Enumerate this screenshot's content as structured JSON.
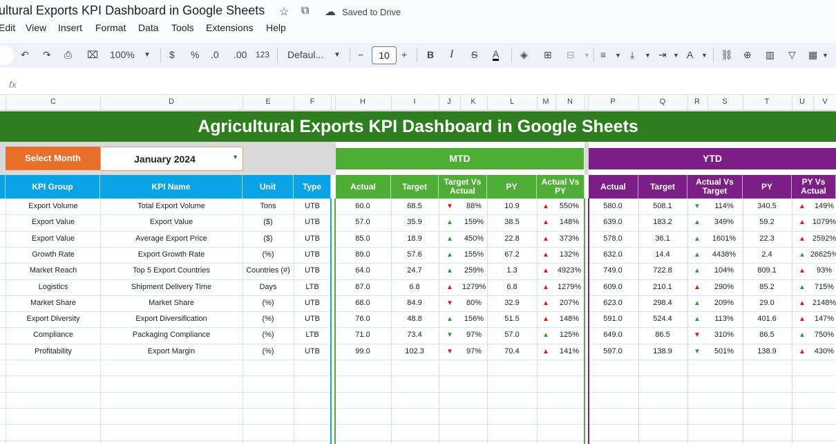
{
  "app": {
    "doc_title": "ultural Exports KPI Dashboard in Google Sheets",
    "saved_status": "Saved to Drive",
    "menu": [
      "Edit",
      "View",
      "Insert",
      "Format",
      "Data",
      "Tools",
      "Extensions",
      "Help"
    ],
    "zoom": "100%",
    "currency": "$",
    "percent": "%",
    "dec_dec": ".0",
    "dec_inc": ".00",
    "number_format": "123",
    "font": "Defaul...",
    "font_size": "10",
    "fx": "fx"
  },
  "columns": [
    "C",
    "D",
    "E",
    "F",
    "H",
    "I",
    "J",
    "K",
    "L",
    "M",
    "N",
    "P",
    "Q",
    "R",
    "S",
    "T",
    "U",
    "V"
  ],
  "dashboard": {
    "title": "Agricultural Exports KPI Dashboard in Google Sheets",
    "select_month_label": "Select Month",
    "selected_month": "January 2024",
    "mtd_label": "MTD",
    "ytd_label": "YTD",
    "headers": {
      "kpi_group": "KPI Group",
      "kpi_name": "KPI Name",
      "unit": "Unit",
      "type": "Type",
      "mtd_actual": "Actual",
      "mtd_target": "Target",
      "mtd_tva": "Target Vs Actual",
      "mtd_py": "PY",
      "mtd_avp": "Actual Vs PY",
      "ytd_actual": "Actual",
      "ytd_target": "Target",
      "ytd_avt": "Actual Vs Target",
      "ytd_py": "PY",
      "ytd_pva": "PY Vs Actual"
    },
    "rows": [
      {
        "group": "Export Volume",
        "name": "Total Export Volume",
        "unit": "Tons",
        "type": "UTB",
        "m_actual": "60.0",
        "m_target": "68.5",
        "m_tva": "88%",
        "m_tva_dir": "dn-r",
        "m_py": "10.9",
        "m_avp": "550%",
        "m_avp_dir": "up-r",
        "y_actual": "580.0",
        "y_target": "508.1",
        "y_avt": "114%",
        "y_avt_dir": "dn-g",
        "y_py": "340.5",
        "y_pva": "149%",
        "y_pva_dir": "up-r"
      },
      {
        "group": "Export Value",
        "name": "Export Value",
        "unit": "($)",
        "type": "UTB",
        "m_actual": "57.0",
        "m_target": "35.9",
        "m_tva": "159%",
        "m_tva_dir": "up-g",
        "m_py": "38.5",
        "m_avp": "148%",
        "m_avp_dir": "up-r",
        "y_actual": "639.0",
        "y_target": "183.2",
        "y_avt": "349%",
        "y_avt_dir": "up-g",
        "y_py": "59.2",
        "y_pva": "1079%",
        "y_pva_dir": "up-r"
      },
      {
        "group": "Export Value",
        "name": "Average Export Price",
        "unit": "($)",
        "type": "UTB",
        "m_actual": "85.0",
        "m_target": "18.9",
        "m_tva": "450%",
        "m_tva_dir": "up-g",
        "m_py": "22.8",
        "m_avp": "373%",
        "m_avp_dir": "up-r",
        "y_actual": "578.0",
        "y_target": "36.1",
        "y_avt": "1601%",
        "y_avt_dir": "up-g",
        "y_py": "22.3",
        "y_pva": "2592%",
        "y_pva_dir": "up-r"
      },
      {
        "group": "Growth Rate",
        "name": "Export Growth Rate",
        "unit": "(%)",
        "type": "UTB",
        "m_actual": "89.0",
        "m_target": "57.6",
        "m_tva": "155%",
        "m_tva_dir": "up-g",
        "m_py": "67.2",
        "m_avp": "132%",
        "m_avp_dir": "up-r",
        "y_actual": "632.0",
        "y_target": "14.4",
        "y_avt": "4438%",
        "y_avt_dir": "up-g",
        "y_py": "2.4",
        "y_pva": "26625%",
        "y_pva_dir": "up-g"
      },
      {
        "group": "Market Reach",
        "name": "Top 5 Export Countries",
        "unit": "Countries (#)",
        "type": "UTB",
        "m_actual": "64.0",
        "m_target": "24.7",
        "m_tva": "259%",
        "m_tva_dir": "up-g",
        "m_py": "1.3",
        "m_avp": "4923%",
        "m_avp_dir": "up-r",
        "y_actual": "749.0",
        "y_target": "722.8",
        "y_avt": "104%",
        "y_avt_dir": "up-g",
        "y_py": "809.1",
        "y_pva": "93%",
        "y_pva_dir": "up-r"
      },
      {
        "group": "Logistics",
        "name": "Shipment Delivery Time",
        "unit": "Days",
        "type": "LTB",
        "m_actual": "87.0",
        "m_target": "6.8",
        "m_tva": "1279%",
        "m_tva_dir": "up-r",
        "m_py": "6.8",
        "m_avp": "1279%",
        "m_avp_dir": "up-r",
        "y_actual": "609.0",
        "y_target": "210.1",
        "y_avt": "290%",
        "y_avt_dir": "up-r",
        "y_py": "85.2",
        "y_pva": "715%",
        "y_pva_dir": "up-g"
      },
      {
        "group": "Market Share",
        "name": "Market Share",
        "unit": "(%)",
        "type": "UTB",
        "m_actual": "68.0",
        "m_target": "84.9",
        "m_tva": "80%",
        "m_tva_dir": "dn-r",
        "m_py": "32.9",
        "m_avp": "207%",
        "m_avp_dir": "up-r",
        "y_actual": "623.0",
        "y_target": "298.4",
        "y_avt": "209%",
        "y_avt_dir": "up-g",
        "y_py": "29.0",
        "y_pva": "2148%",
        "y_pva_dir": "up-r"
      },
      {
        "group": "Export Diversity",
        "name": "Export Diversification",
        "unit": "(%)",
        "type": "UTB",
        "m_actual": "76.0",
        "m_target": "48.8",
        "m_tva": "156%",
        "m_tva_dir": "up-g",
        "m_py": "51.5",
        "m_avp": "148%",
        "m_avp_dir": "up-r",
        "y_actual": "591.0",
        "y_target": "524.4",
        "y_avt": "113%",
        "y_avt_dir": "up-g",
        "y_py": "401.6",
        "y_pva": "147%",
        "y_pva_dir": "up-r"
      },
      {
        "group": "Compliance",
        "name": "Packaging Compliance",
        "unit": "(%)",
        "type": "LTB",
        "m_actual": "71.0",
        "m_target": "73.4",
        "m_tva": "97%",
        "m_tva_dir": "dn-g",
        "m_py": "57.0",
        "m_avp": "125%",
        "m_avp_dir": "up-g",
        "y_actual": "649.0",
        "y_target": "86.5",
        "y_avt": "310%",
        "y_avt_dir": "dn-r",
        "y_py": "86.5",
        "y_pva": "750%",
        "y_pva_dir": "up-g"
      },
      {
        "group": "Profitability",
        "name": "Export Margin",
        "unit": "(%)",
        "type": "UTB",
        "m_actual": "99.0",
        "m_target": "102.3",
        "m_tva": "97%",
        "m_tva_dir": "dn-r",
        "m_py": "70.4",
        "m_avp": "141%",
        "m_avp_dir": "up-r",
        "y_actual": "597.0",
        "y_target": "138.9",
        "y_avt": "501%",
        "y_avt_dir": "dn-g",
        "y_py": "138.9",
        "y_pva": "430%",
        "y_pva_dir": "up-r"
      }
    ]
  },
  "colors": {
    "banner": "#2e7d1f",
    "mtd": "#4fae36",
    "ytd": "#7b1f86",
    "header_blue": "#0aa3e6",
    "select_month": "#e8702a"
  }
}
